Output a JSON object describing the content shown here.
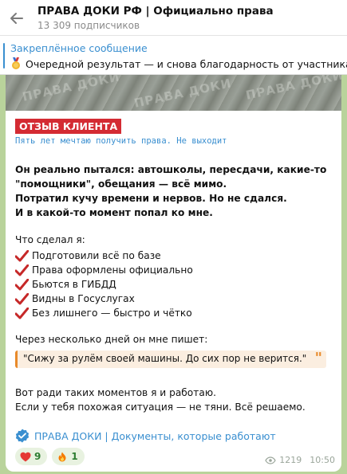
{
  "header": {
    "channel_name": "ПРАВА ДОКИ РФ | Официально права",
    "subscribers": "13 309 подписчиков"
  },
  "pinned": {
    "label": "Закреплённое сообщение",
    "preview": "Очередной результат — и снова благодарность от участника СВ"
  },
  "message": {
    "photo_watermark": "ПРАВА ДОКИ",
    "badge": "ОТЗЫВ КЛИЕНТА",
    "subtitle": "Пять лет мечтаю получить права. Не выходит",
    "intro_lines": [
      "Он реально пытался: автошколы, пересдачи, какие-то",
      "\"помощники\", обещания — всё мимо.",
      "Потратил кучу времени и нервов. Но не сдался.",
      "И в какой-то момент попал ко мне."
    ],
    "did_title": "Что сделал я:",
    "checklist": [
      "Подготовили всё по базе",
      "Права оформлены официально",
      "Бьются в ГИБДД",
      "Видны в Госуслугах",
      "Без лишнего — быстро и чётко"
    ],
    "after_days": "Через несколько дней он мне пишет:",
    "quote": "\"Сижу за рулём своей машины. До сих пор не верится.\"",
    "quote_mark": "\"",
    "closing_lines": [
      "Вот ради таких моментов я и работаю.",
      "Если у тебя похожая ситуация — не тяни. Всё решаемо."
    ],
    "signature_link": "ПРАВА ДОКИ | Документы, которые работают",
    "reactions": [
      {
        "emoji": "heart",
        "count": "9"
      },
      {
        "emoji": "fire",
        "count": "1"
      }
    ],
    "views": "1219",
    "time": "10:50"
  },
  "colors": {
    "accent": "#3a8fd0",
    "badge_red": "#d42b33",
    "quote_orange": "#e88a2a",
    "chat_bg": "#b9d39b"
  }
}
